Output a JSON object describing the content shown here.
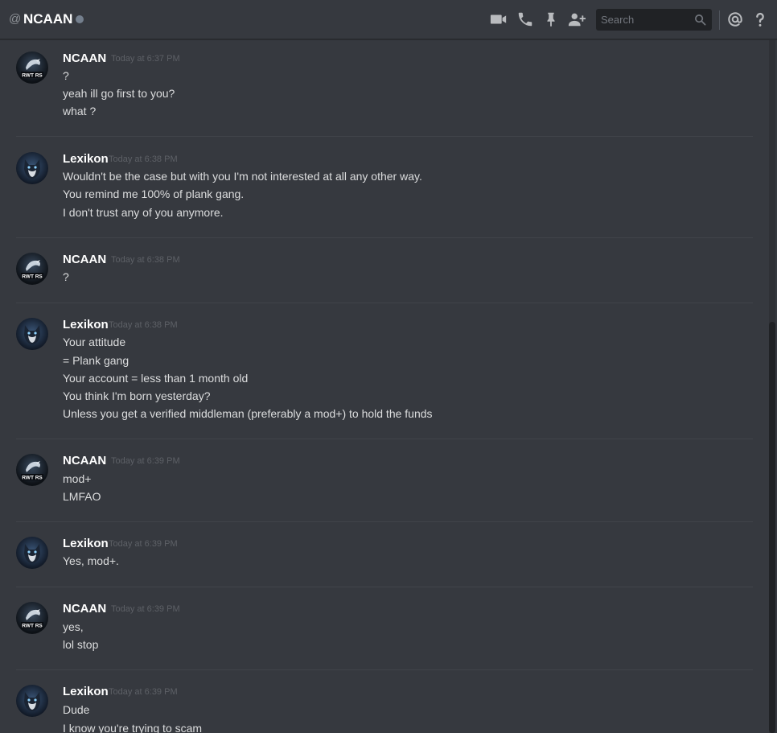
{
  "header": {
    "at_symbol": "@",
    "channel_name": "NCAAN",
    "search_placeholder": "Search",
    "icons": [
      "video-call-icon",
      "voice-call-icon",
      "pin-icon",
      "add-friend-icon",
      "search-icon",
      "mention-icon",
      "help-icon"
    ]
  },
  "colors": {
    "background": "#36393f",
    "header_divider": "#25272b",
    "username": "#ffffff",
    "message_text": "#dcddde",
    "timestamp": "#5d6066",
    "offline_dot": "#747f8d"
  },
  "messages": [
    {
      "author": "NCAAN",
      "time": "Today at 6:37 PM",
      "avatar_text": "RWT RS",
      "lines": [
        "?",
        "yeah ill go first to you?",
        "what ?"
      ]
    },
    {
      "author": "Lexikon",
      "time": "Today at 6:38 PM",
      "lines": [
        "Wouldn't be the case but with you I'm not interested at all any other way.",
        "You remind me 100% of plank gang.",
        "I don't trust any of you anymore."
      ]
    },
    {
      "author": "NCAAN",
      "time": "Today at 6:38 PM",
      "avatar_text": "RWT RS",
      "lines": [
        "?"
      ]
    },
    {
      "author": "Lexikon",
      "time": "Today at 6:38 PM",
      "lines": [
        "Your attitude",
        "= Plank gang",
        "Your account = less than 1 month old",
        "You think I'm born yesterday?",
        "Unless you get a verified middleman (preferably a mod+) to hold the funds"
      ]
    },
    {
      "author": "NCAAN",
      "time": "Today at 6:39 PM",
      "avatar_text": "RWT RS",
      "lines": [
        "mod+",
        "LMFAO"
      ]
    },
    {
      "author": "Lexikon",
      "time": "Today at 6:39 PM",
      "lines": [
        "Yes, mod+."
      ]
    },
    {
      "author": "NCAAN",
      "time": "Today at 6:39 PM",
      "avatar_text": "RWT RS",
      "lines": [
        "yes,",
        "lol stop"
      ]
    },
    {
      "author": "Lexikon",
      "time": "Today at 6:39 PM",
      "lines": [
        "Dude",
        "I know you're trying to scam"
      ]
    }
  ]
}
